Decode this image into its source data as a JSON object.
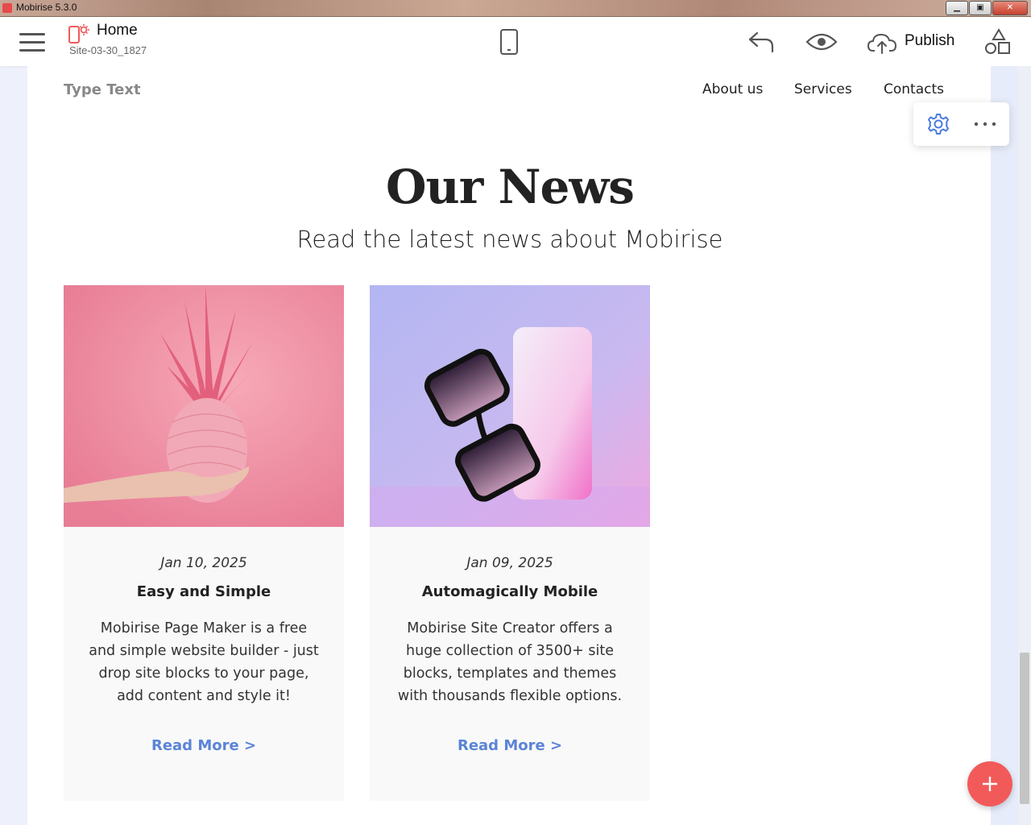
{
  "window": {
    "title": "Mobirise 5.3.0",
    "minimize": "▁",
    "maximize": "▣",
    "close": "✕"
  },
  "toolbar": {
    "page_title": "Home",
    "site_name": "Site-03-30_1827",
    "publish_label": "Publish",
    "icons": [
      "menu-icon",
      "page-icon",
      "mobile-preview-icon",
      "undo-icon",
      "preview-eye-icon",
      "cloud-upload-icon",
      "blocks-icon"
    ]
  },
  "site_nav": {
    "brand": "Type Text",
    "links": [
      "About us",
      "Services",
      "Contacts"
    ]
  },
  "section": {
    "title": "Our News",
    "subtitle": "Read the latest news about Mobirise"
  },
  "cards": [
    {
      "date": "Jan 10, 2025",
      "title": "Easy and Simple",
      "text": "Mobirise Page Maker is a free and simple website builder - just drop site blocks to your page, add content and style it!",
      "link": "Read More >",
      "image": "pink pineapple held in hand on pink background"
    },
    {
      "date": "Jan 09, 2025",
      "title": "Automagically Mobile",
      "text": "Mobirise Site Creator offers a huge collection of 3500+ site blocks, templates and themes with thousands flexible options.",
      "link": "Read More >",
      "image": "sunglasses leaning on pink glowing box"
    }
  ],
  "block_tools": {
    "icons": [
      "gear-icon",
      "more-icon"
    ]
  },
  "fab": {
    "icon": "plus-icon"
  },
  "colors": {
    "accent": "#5b84d6",
    "fab": "#f25a5a",
    "gear": "#4a7ce0"
  }
}
